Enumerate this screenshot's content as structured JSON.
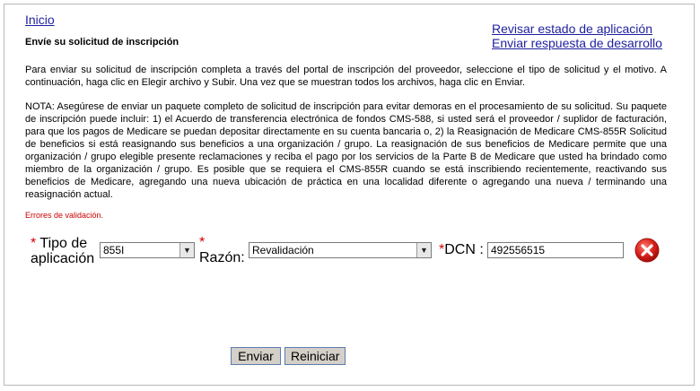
{
  "nav": {
    "home_link": "Inicio",
    "status_link": "Revisar estado de aplicación",
    "dev_response_link": "Enviar respuesta de desarrollo"
  },
  "page": {
    "title": "Envíe su solicitud de inscripción",
    "instructions": "Para enviar su solicitud de inscripción completa a través del portal de inscripción del proveedor, seleccione el tipo de solicitud y el motivo. A continuación, haga clic en Elegir archivo y Subir. Una vez que se muestran todos los archivos, haga clic en Enviar.",
    "note": "NOTA: Asegúrese de enviar un paquete completo de solicitud de inscripción para evitar demoras en el procesamiento de su solicitud. Su paquete de inscripción puede incluir: 1) el Acuerdo de transferencia electrónica de fondos CMS-588, si usted será el proveedor / suplidor de facturación, para que los pagos de Medicare se puedan depositar directamente en su cuenta bancaria o, 2) la Reasignación de Medicare CMS-855R Solicitud de beneficios si está reasignando sus beneficios a una organización / grupo. La reasignación de sus beneficios de Medicare permite que una organización / grupo elegible presente reclamaciones y reciba el pago por los servicios de la Parte B de Medicare que usted ha brindado como miembro de la organización / grupo. Es posible que se requiera el CMS-855R cuando se está inscribiendo recientemente, reactivando sus beneficios de Medicare, agregando una nueva ubicación de práctica en una localidad diferente o agregando una nueva / terminando una reasignación actual.",
    "validation_error": "Errores de validación."
  },
  "form": {
    "required_mark": "*",
    "tipo_label_line1": "Tipo de",
    "tipo_label_line2": "aplicación",
    "tipo_value": "855I",
    "razon_label": "Razón:",
    "razon_value": "Revalidación",
    "dcn_label": "DCN :",
    "dcn_value": "492556515"
  },
  "buttons": {
    "submit": "Enviar",
    "reset": "Reiniciar"
  },
  "colors": {
    "link": "#1f1fa0",
    "error": "#cc0000",
    "clear_icon": "#d9221c"
  }
}
